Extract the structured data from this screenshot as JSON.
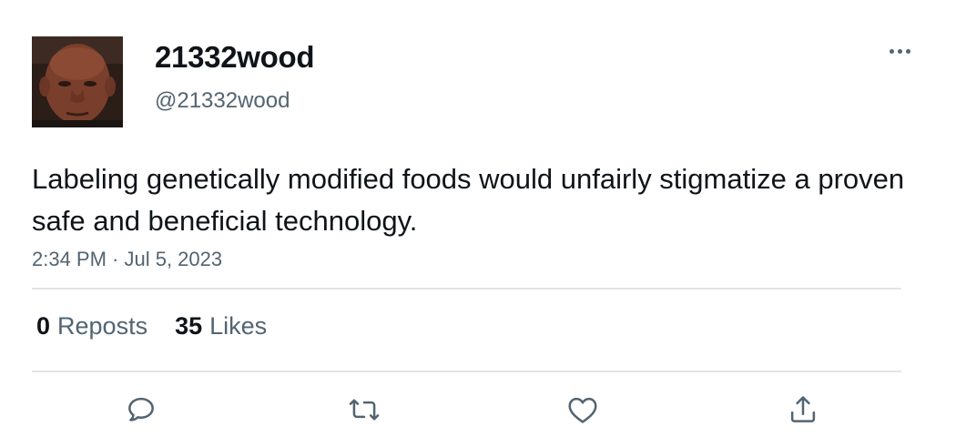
{
  "user": {
    "display_name": "21332wood",
    "handle": "@21332wood",
    "avatar": "profile-photo"
  },
  "tweet": {
    "text": "Labeling genetically modified foods would unfairly stigmatize a proven safe and beneficial technology.",
    "timestamp": "2:34 PM · Jul 5, 2023"
  },
  "stats": {
    "reposts_count": "0",
    "reposts_label": "Reposts",
    "likes_count": "35",
    "likes_label": "Likes"
  },
  "actions": {
    "reply_icon": "speech-bubble-icon",
    "repost_icon": "repost-arrows-icon",
    "like_icon": "heart-icon",
    "share_icon": "share-upload-icon",
    "more_icon": "ellipsis-icon"
  },
  "colors": {
    "text_primary": "#0f1419",
    "text_secondary": "#536471",
    "divider": "#e1e4e7",
    "background": "#ffffff"
  }
}
